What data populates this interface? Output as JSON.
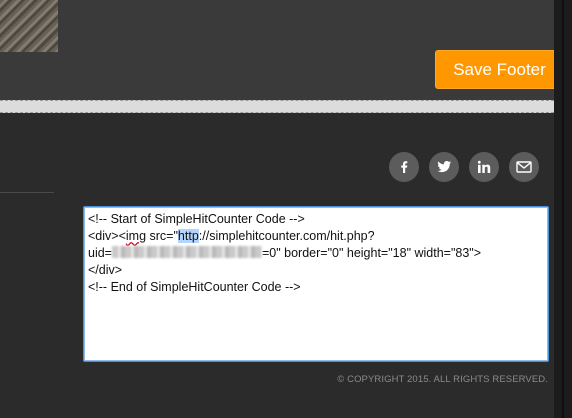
{
  "toolbar": {
    "save_label": "Save Footer"
  },
  "social": {
    "items": [
      {
        "name": "facebook",
        "icon": "facebook-icon"
      },
      {
        "name": "twitter",
        "icon": "twitter-icon"
      },
      {
        "name": "linkedin",
        "icon": "linkedin-icon"
      },
      {
        "name": "email",
        "icon": "mail-icon"
      }
    ]
  },
  "code": {
    "line1": "<!-- Start of SimpleHitCounter Code -->",
    "line2_prefix": "<div><",
    "line2_tag": "img",
    "line2_mid": " src=\"",
    "line2_selected": "http",
    "line2_suffix": "://simplehitcounter.com/hit.php?",
    "line3_prefix": "uid=",
    "line3_suffix": "=0\" border=\"0\" height=\"18\" width=\"83\">",
    "line4": "</div>",
    "line5": "<!-- End of SimpleHitCounter Code -->"
  },
  "footer": {
    "copyright": "© COPYRIGHT 2015. ALL RIGHTS RESERVED."
  },
  "colors": {
    "accent": "#ff9800",
    "social_bg": "#5c5c5c",
    "selection": "#b3d4fc",
    "editor_border": "#4a90d9"
  }
}
